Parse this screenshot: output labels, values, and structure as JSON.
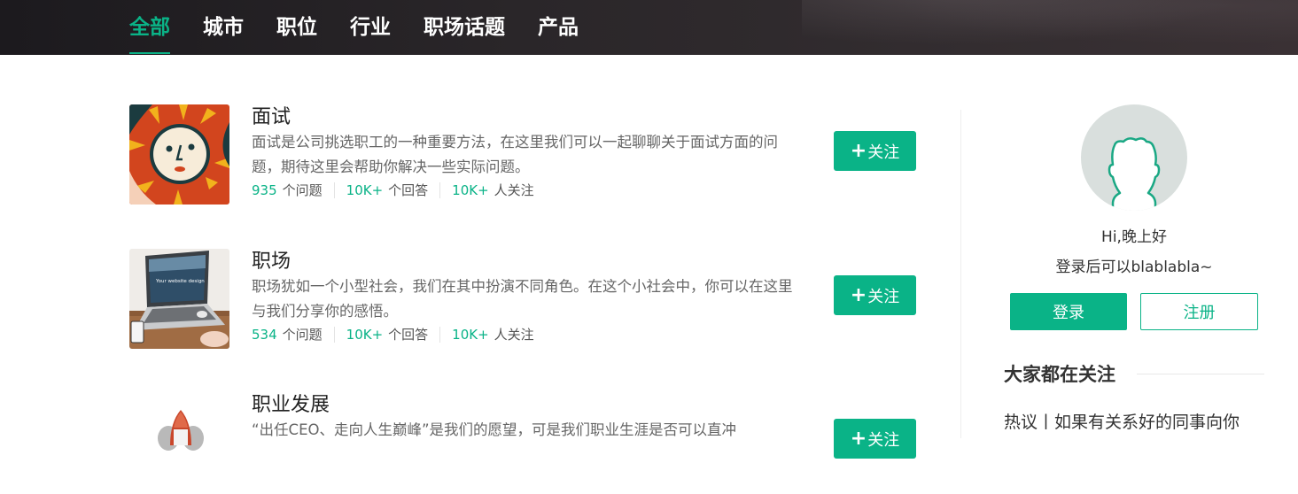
{
  "nav": {
    "items": [
      "全部",
      "城市",
      "职位",
      "行业",
      "职场话题",
      "产品"
    ],
    "active_index": 0
  },
  "colors": {
    "accent": "#0ab387",
    "header_bg": "#231f22",
    "avatar_bg": "#d9dfdd"
  },
  "topics": [
    {
      "title": "面试",
      "description": "面试是公司挑选职工的一种重要方法，在这里我们可以一起聊聊关于面试方面的问题，期待这里会帮助你解决一些实际问题。",
      "questions_num": "935",
      "questions_label": "个问题",
      "answers_num": "10K+",
      "answers_label": "个回答",
      "followers_num": "10K+",
      "followers_label": "人关注",
      "follow_label": "关注",
      "image": "face-illustration"
    },
    {
      "title": "职场",
      "description": "职场犹如一个小型社会，我们在其中扮演不同角色。在这个小社会中，你可以在这里与我们分享你的感悟。",
      "questions_num": "534",
      "questions_label": "个问题",
      "answers_num": "10K+",
      "answers_label": "个回答",
      "followers_num": "10K+",
      "followers_label": "人关注",
      "follow_label": "关注",
      "image": "laptop-photo",
      "laptop_screen_text": "Your website design"
    },
    {
      "title": "职业发展",
      "description": "“出任CEO、走向人生巅峰”是我们的愿望，可是我们职业生涯是否可以直冲",
      "follow_label": "关注",
      "image": "rocket-illustration"
    }
  ],
  "sidebar": {
    "greeting": "Hi,晚上好",
    "login_tip": "登录后可以blablabla~",
    "login_label": "登录",
    "register_label": "注册",
    "section_title": "大家都在关注",
    "hot_item": "热议丨如果有关系好的同事向你"
  },
  "icons": {
    "plus": "plus-icon",
    "avatar": "user-silhouette-icon"
  }
}
